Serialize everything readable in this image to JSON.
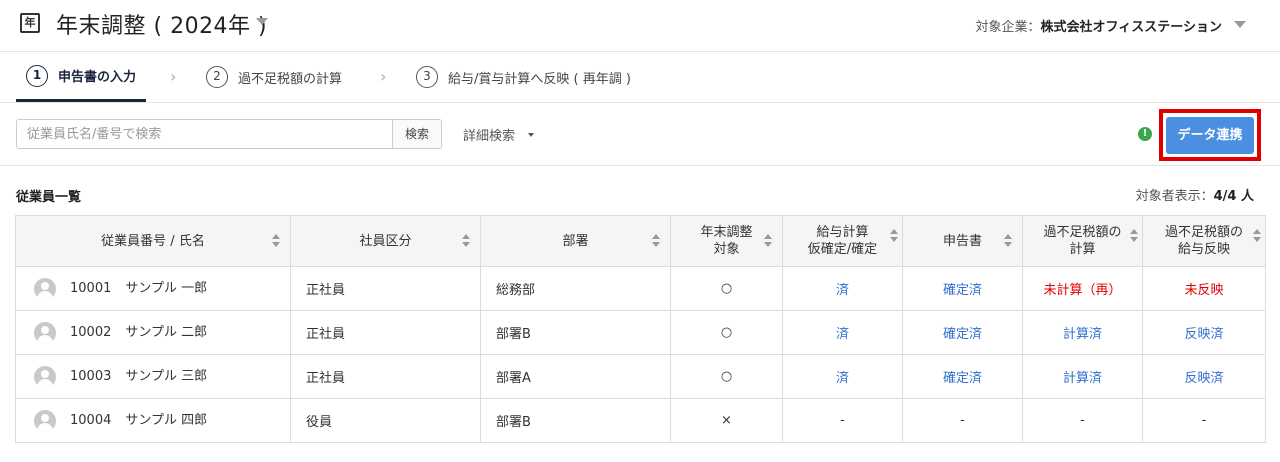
{
  "header": {
    "app_icon": "年",
    "title": "年末調整 ( 2024年 )",
    "company_label": "対象企業：",
    "company_name": "株式会社オフィスステーション"
  },
  "steps": [
    {
      "num": "1",
      "label": "申告書の入力"
    },
    {
      "num": "2",
      "label": "過不足税額の計算"
    },
    {
      "num": "3",
      "label": "給与/賞与計算へ反映 ( 再年調 )"
    }
  ],
  "toolbar": {
    "search_placeholder": "従業員氏名/番号で検索",
    "search_button": "検索",
    "advanced_search": "詳細検索",
    "alert_icon": "!",
    "data_link_button": "データ連携",
    "accent_color": "#4a8fe0",
    "highlight_color": "#e00000"
  },
  "list": {
    "title": "従業員一覧",
    "count_label": "対象者表示：",
    "count_value": "4/4 人"
  },
  "table": {
    "columns": [
      {
        "line1": "従業員番号 / 氏名",
        "line2": ""
      },
      {
        "line1": "社員区分",
        "line2": ""
      },
      {
        "line1": "部署",
        "line2": ""
      },
      {
        "line1": "年末調整",
        "line2": "対象"
      },
      {
        "line1": "給与計算",
        "line2": "仮確定/確定"
      },
      {
        "line1": "申告書",
        "line2": ""
      },
      {
        "line1": "過不足税額の",
        "line2": "計算"
      },
      {
        "line1": "過不足税額の",
        "line2": "給与反映"
      }
    ],
    "rows": [
      {
        "no": "10001",
        "name": "サンプル 一郎",
        "type": "正社員",
        "dept": "総務部",
        "target": "○",
        "payroll": "済",
        "form": "確定済",
        "calc": "未計算（再）",
        "reflect": "未反映"
      },
      {
        "no": "10002",
        "name": "サンプル 二郎",
        "type": "正社員",
        "dept": "部署B",
        "target": "○",
        "payroll": "済",
        "form": "確定済",
        "calc": "計算済",
        "reflect": "反映済"
      },
      {
        "no": "10003",
        "name": "サンプル 三郎",
        "type": "正社員",
        "dept": "部署A",
        "target": "○",
        "payroll": "済",
        "form": "確定済",
        "calc": "計算済",
        "reflect": "反映済"
      },
      {
        "no": "10004",
        "name": "サンプル 四郎",
        "type": "役員",
        "dept": "部署B",
        "target": "×",
        "payroll": "-",
        "form": "-",
        "calc": "-",
        "reflect": "-"
      }
    ]
  }
}
